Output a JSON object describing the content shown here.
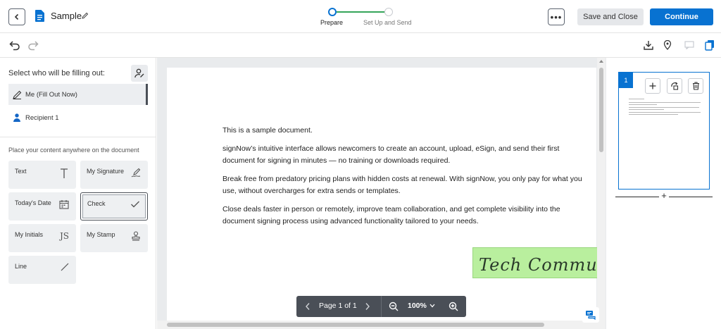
{
  "header": {
    "doc_title": "Sample",
    "steps": [
      {
        "label": "Prepare",
        "state": "current"
      },
      {
        "label": "Set Up and Send",
        "state": "pending"
      }
    ],
    "more_label": "•••",
    "save_close_label": "Save and Close",
    "continue_label": "Continue",
    "accent_color": "#0872d1",
    "progress_color": "#35a55a"
  },
  "left_panel": {
    "title": "Select who will be filling out:",
    "signers": [
      {
        "label": "Me (Fill Out Now)",
        "selected": true
      },
      {
        "label": "Recipient 1",
        "selected": false
      }
    ],
    "place_hint": "Place your content anywhere on the document",
    "tools": [
      {
        "label": "Text",
        "icon": "text-t-icon"
      },
      {
        "label": "My Signature",
        "icon": "signature-pen-icon"
      },
      {
        "label": "Today's Date",
        "icon": "calendar-icon"
      },
      {
        "label": "Check",
        "icon": "checkmark-icon",
        "selected": true
      },
      {
        "label": "My Initials",
        "icon": "initials-js-icon"
      },
      {
        "label": "My Stamp",
        "icon": "stamp-icon"
      },
      {
        "label": "Line",
        "icon": "line-icon"
      }
    ]
  },
  "document": {
    "paragraphs": [
      "This is a sample document.",
      "signNow’s intuitive interface allows newcomers to create an account, upload, eSign, and send their first document for signing in minutes — no training or downloads required.",
      "Break free from predatory pricing plans with hidden costs at renewal. With signNow, you only pay for what you use, without overcharges for extra sends or templates.",
      "Close deals faster in person or remotely, improve team collaboration, and get complete visibility into the document signing process using advanced functionality tailored to your needs."
    ],
    "signature_text": "Tech Commuters",
    "signature_bg": "#b9ef9e"
  },
  "pager": {
    "page_label": "Page 1 of 1",
    "zoom_label": "100%"
  },
  "right_panel": {
    "page_number": "1",
    "add_page_label": "+"
  }
}
